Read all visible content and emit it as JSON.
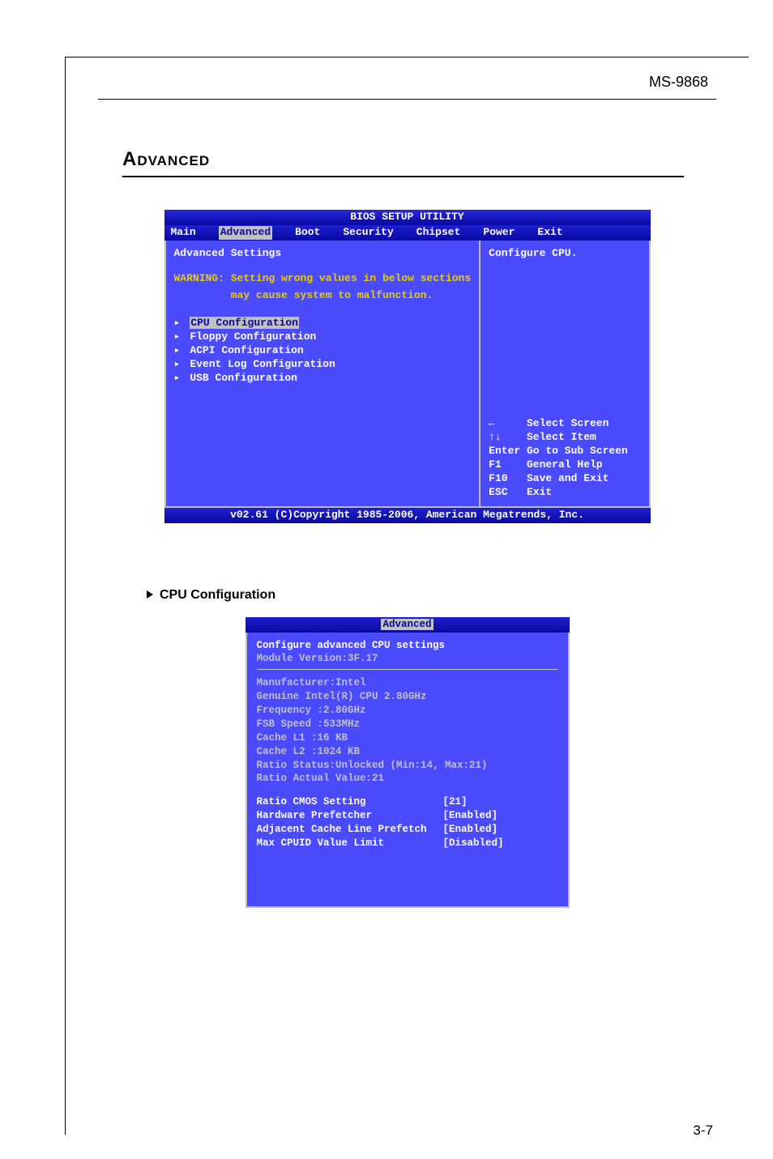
{
  "doc": {
    "header": "MS-9868",
    "sectionTitle": "Advanced",
    "pageNum": "3-7"
  },
  "bios1": {
    "title": "BIOS SETUP UTILITY",
    "menu": [
      "Main",
      "Advanced",
      "Boot",
      "Security",
      "Chipset",
      "Power",
      "Exit"
    ],
    "selectedMenu": "Advanced",
    "heading": "Advanced Settings",
    "warning1": "WARNING: Setting wrong values in below sections",
    "warning2": "         may cause system to malfunction.",
    "items": [
      "CPU Configuration",
      "Floppy Configuration",
      "ACPI Configuration",
      "Event Log Configuration",
      "USB Configuration"
    ],
    "selectedItem": "CPU Configuration",
    "desc": "Configure CPU.",
    "keys": "←     Select Screen\n↑↓    Select Item\nEnter Go to Sub Screen\nF1    General Help\nF10   Save and Exit\nESC   Exit",
    "footer": "v02.61 (C)Copyright 1985-2006, American Megatrends, Inc."
  },
  "sub": {
    "title": "CPU Configuration"
  },
  "cpu": {
    "menuLabel": "Advanced",
    "heading": "Configure advanced CPU settings",
    "module": "Module Version:3F.17",
    "info": [
      "Manufacturer:Intel",
      "Genuine Intel(R) CPU 2.80GHz",
      "Frequency   :2.80GHz",
      "FSB Speed   :533MHz",
      "Cache L1    :16 KB",
      "Cache L2    :1024 KB",
      "Ratio Status:Unlocked (Min:14, Max:21)",
      "Ratio Actual Value:21"
    ],
    "options": [
      {
        "label": "Ratio CMOS Setting",
        "value": "[21]"
      },
      {
        "label": "Hardware Prefetcher",
        "value": "[Enabled]"
      },
      {
        "label": "Adjacent Cache Line Prefetch",
        "value": "[Enabled]"
      },
      {
        "label": "Max CPUID Value Limit",
        "value": "[Disabled]"
      }
    ]
  }
}
